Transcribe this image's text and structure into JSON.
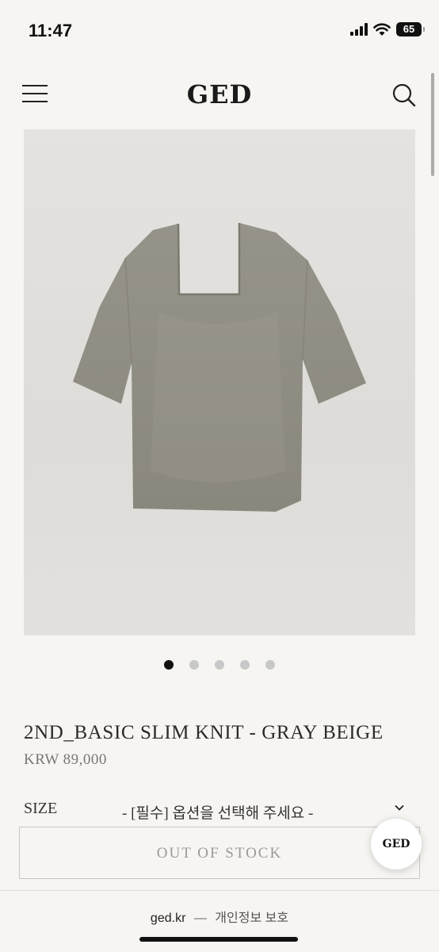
{
  "status_bar": {
    "time": "11:47",
    "battery": "65"
  },
  "header": {
    "logo": "GED"
  },
  "product": {
    "image_icon": "knit-top-image",
    "title": "2ND_BASIC SLIM KNIT - GRAY BEIGE",
    "price": "KRW 89,000",
    "carousel": {
      "total": 5,
      "active_index": 0
    }
  },
  "options": {
    "size_label": "SIZE",
    "size_select_value": "- [필수] 옵션을 선택해 주세요 -"
  },
  "actions": {
    "out_of_stock_label": "OUT OF STOCK"
  },
  "floating_badge": {
    "label": "GED"
  },
  "footer": {
    "domain": "ged.kr",
    "separator": "—",
    "privacy": "개인정보 보호"
  },
  "colors": {
    "background": "#f7f5f2",
    "garment": "#8f8c82",
    "active_dot": "#111111"
  }
}
